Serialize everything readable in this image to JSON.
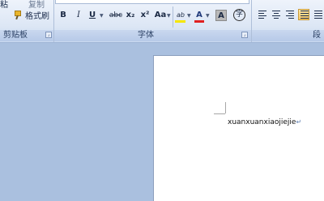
{
  "clipboard": {
    "paste_label": "粘",
    "copy_label": "复制",
    "format_painter_label": "格式刷",
    "group_label": "剪贴板"
  },
  "font_group": {
    "group_label": "字体",
    "bold": "B",
    "italic": "I",
    "underline": "U",
    "strikethrough": "abc",
    "subscript": "x₂",
    "superscript": "x²",
    "change_case": "Aa",
    "highlight": "ab",
    "font_color": "A",
    "char_shading": "A",
    "enclose_char": "字"
  },
  "paragraph_group": {
    "group_label": "段"
  },
  "document": {
    "text": "xuanxuanxiaojiejie",
    "paragraph_mark": "↵"
  },
  "colors": {
    "highlight": "#f5e600",
    "font_color": "#e02020"
  }
}
